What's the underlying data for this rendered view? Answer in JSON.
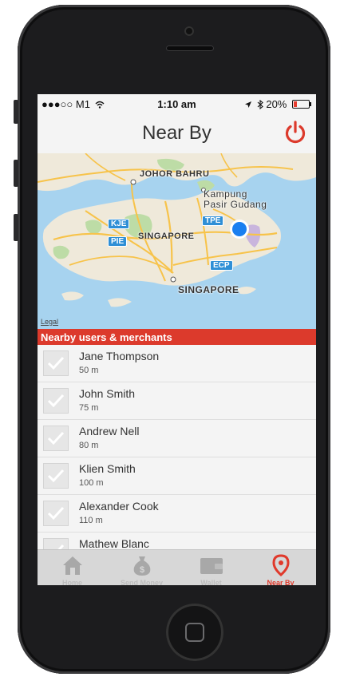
{
  "status_bar": {
    "carrier": "●●●○○ M1",
    "time": "1:10 am",
    "battery": "20%",
    "battery_level": 0.2
  },
  "nav": {
    "title": "Near By"
  },
  "map": {
    "labels": [
      "JOHOR BAHRU",
      "Kampung",
      "Pasir Gudang",
      "SINGAPORE",
      "SINGAPORE"
    ],
    "highways": [
      "KJE",
      "PIE",
      "TPE",
      "ECP"
    ],
    "legal": "Legal"
  },
  "section_title": "Nearby users & merchants",
  "nearby": [
    {
      "name": "Jane Thompson",
      "distance": "50 m"
    },
    {
      "name": "John Smith",
      "distance": "75 m"
    },
    {
      "name": "Andrew Nell",
      "distance": "80 m"
    },
    {
      "name": "Klien Smith",
      "distance": "100 m"
    },
    {
      "name": "Alexander Cook",
      "distance": "110 m"
    },
    {
      "name": "Mathew Blanc",
      "distance": ""
    }
  ],
  "tabs": [
    {
      "label": "Home",
      "icon": "home-icon",
      "active": false
    },
    {
      "label": "Send Money",
      "icon": "money-bag-icon",
      "active": false
    },
    {
      "label": "Wallet",
      "icon": "wallet-icon",
      "active": false
    },
    {
      "label": "Near By",
      "icon": "location-pin-icon",
      "active": true
    }
  ],
  "colors": {
    "accent": "#dc3a2c",
    "location_dot": "#1a7ff0",
    "water": "#a7d3ef"
  }
}
